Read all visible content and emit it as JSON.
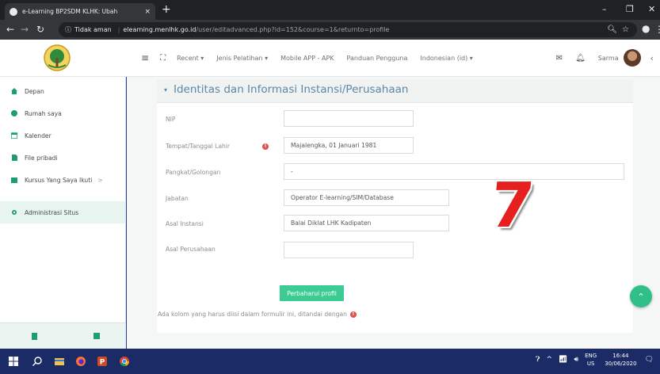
{
  "browser": {
    "tab_title": "e-Learning BP2SDM KLHK: Ubah",
    "tab_close": "×",
    "new_tab": "+",
    "not_secure": "Tidak aman",
    "url_host": "elearning.menlhk.go.id",
    "url_path": "/user/editadvanced.php?id=152&course=1&returnto=profile"
  },
  "topnav": {
    "menu": [
      "Recent",
      "Jenis Pelatihan",
      "Mobile APP - APK",
      "Panduan Pengguna",
      "Indonesian (id)"
    ],
    "user_name": "Sarma"
  },
  "sidebar": {
    "items": [
      {
        "label": "Depan",
        "icon": "home-icon"
      },
      {
        "label": "Rumah saya",
        "icon": "dashboard-icon"
      },
      {
        "label": "Kalender",
        "icon": "calendar-icon"
      },
      {
        "label": "File pribadi",
        "icon": "file-icon"
      },
      {
        "label": "Kursus Yang Saya Ikuti",
        "icon": "folder-icon"
      },
      {
        "label": "Administrasi Situs",
        "icon": "gear-icon"
      }
    ],
    "submenu_caret": ">"
  },
  "form": {
    "section_title": "Identitas dan Informasi Instansi/Perusahaan",
    "fields": [
      {
        "label": "NIP",
        "value": ""
      },
      {
        "label": "Tempat/Tanggal Lahir",
        "value": "Majalengka, 01 Januari 1981"
      },
      {
        "label": "Pangkat/Golongan",
        "value": "-"
      },
      {
        "label": "Jabatan",
        "value": "Operator E-learning/SIM/Database"
      },
      {
        "label": "Asal Instansi",
        "value": "Balai Diklat LHK Kadipaten"
      },
      {
        "label": "Asal Perusahaan",
        "value": ""
      }
    ],
    "submit_label": "Perbaharui profil",
    "required_note": "Ada kolom yang harus diisi dalam formulir ini, ditandai dengan"
  },
  "overlay_number": "7",
  "taskbar": {
    "lang": "ENG",
    "region": "US",
    "time": "16:44",
    "date": "30/06/2020"
  },
  "colors": {
    "accent": "#3ccb93",
    "section_title": "#5b87a8",
    "required": "#d9534f",
    "overlay": "#e6201f"
  }
}
